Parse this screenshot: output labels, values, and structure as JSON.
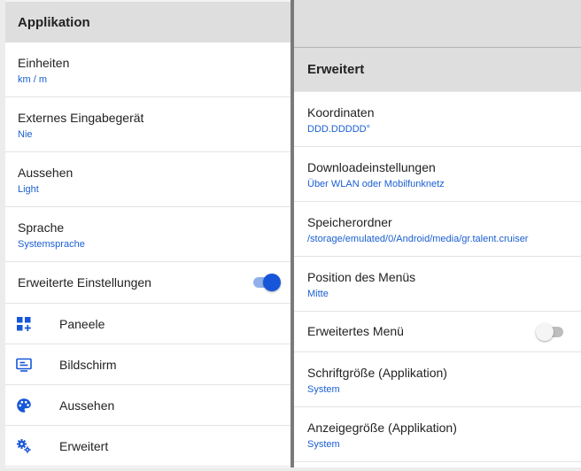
{
  "left": {
    "header": "Applikation",
    "rows": [
      {
        "title": "Einheiten",
        "value": "km / m"
      },
      {
        "title": "Externes Eingabegerät",
        "value": "Nie"
      },
      {
        "title": "Aussehen",
        "value": "Light"
      },
      {
        "title": "Sprache",
        "value": "Systemsprache"
      }
    ],
    "advanced_toggle": {
      "label": "Erweiterte Einstellungen",
      "state": "on"
    },
    "nav": [
      {
        "label": "Paneele",
        "icon": "panels-add-icon"
      },
      {
        "label": "Bildschirm",
        "icon": "screen-icon"
      },
      {
        "label": "Aussehen",
        "icon": "palette-icon"
      },
      {
        "label": "Erweitert",
        "icon": "gears-icon"
      }
    ]
  },
  "right": {
    "header": "Erweitert",
    "rows": [
      {
        "title": "Koordinaten",
        "value": "DDD.DDDDD°"
      },
      {
        "title": "Downloadeinstellungen",
        "value": "Über WLAN oder Mobilfunknetz"
      },
      {
        "title": "Speicherordner",
        "value": "/storage/emulated/0/Android/media/gr.talent.cruiser"
      },
      {
        "title": "Position des Menüs",
        "value": "Mitte"
      }
    ],
    "menu_toggle": {
      "label": "Erweitertes Menü",
      "state": "off"
    },
    "rows2": [
      {
        "title": "Schriftgröße (Applikation)",
        "value": "System"
      },
      {
        "title": "Anzeigegröße (Applikation)",
        "value": "System"
      }
    ]
  },
  "colors": {
    "accent": "#1756d8",
    "value_text": "#1a5fd1",
    "header_bg": "#dedede"
  }
}
